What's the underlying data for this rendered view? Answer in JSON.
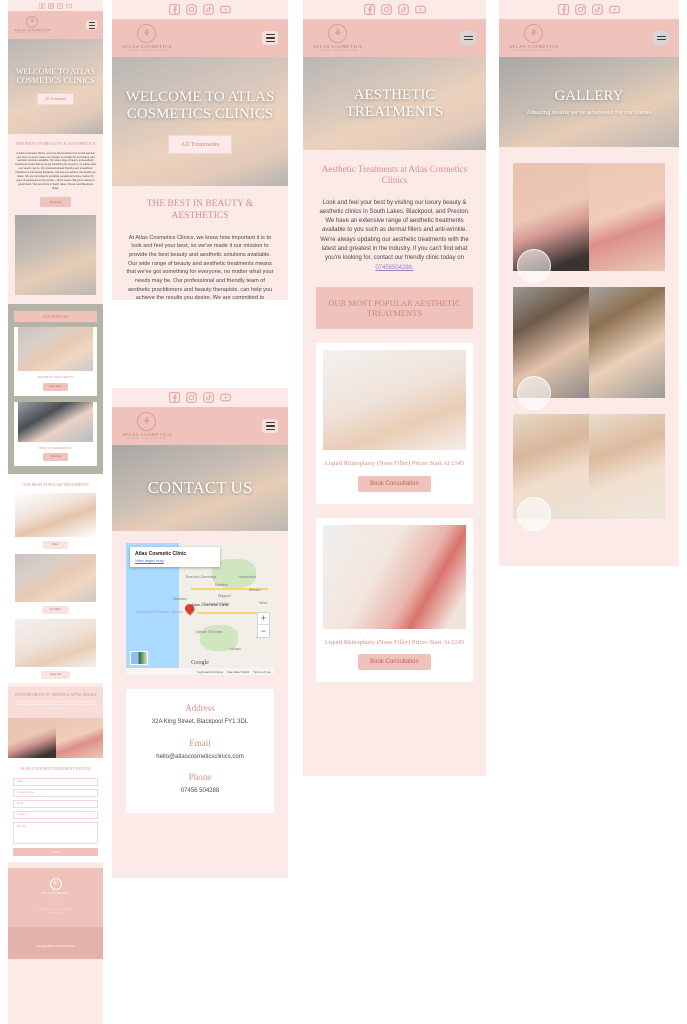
{
  "brand": {
    "name": "ATLAS COSMETICS",
    "tagline": "COSMETIC CLINIC & ACADEMY",
    "accent": "#d98f87",
    "band": "#efc3bc",
    "page_bg": "#fbeae7"
  },
  "social": [
    {
      "name": "facebook-icon",
      "label": "Facebook"
    },
    {
      "name": "instagram-icon",
      "label": "Instagram"
    },
    {
      "name": "tiktok-icon",
      "label": "TikTok"
    },
    {
      "name": "youtube-icon",
      "label": "YouTube"
    }
  ],
  "screens": [
    {
      "id": "home",
      "hero_title": "WELCOME TO ATLAS COSMETICS CLINICS",
      "hero_button": "All Treatments",
      "section_title": "THE BEST IN BEAUTY & AESTHETICS",
      "body": "At Atlas Cosmetics Clinics, we know how important it is to look and feel your best, so we've made it our mission to provide the best beauty and aesthetic solutions available. Our wide range of beauty and aesthetic treatments means that we've got something for everyone, no matter what your needs may be. Our professional and friendly team of aesthetic practitioners and beauty therapists, can help you achieve the results you desire. We are committed to providing exceptional service, backed by years of experience in the industry—which means that you're always in good hands. Visit our clinics in South Lakes, Preston and Blackpool today!",
      "about_button": "About Us",
      "services_band": "OUR SERVICES",
      "services": [
        {
          "title": "AESTHETIC TREATMENTS",
          "button": "View Here"
        },
        {
          "title": "BEAUTY TREATMENTS",
          "button": "About Us"
        }
      ],
      "popular_title": "OUR MOST POPULAR TREATMENTS",
      "popular": [
        {
          "button": "Botox"
        },
        {
          "button": "Lip Fillers"
        },
        {
          "button": "Nose Job"
        }
      ],
      "results_title": "STUNNING RESULTS - BEFORE & AFTER IMAGES",
      "results_body": "We offer non-surgical beauty & aesthetics treatments from our cosmetics clinics in South Lakes, Preston & Blackpool. Take a look at some of the results we've achieved for some of our clients.",
      "form_title": "BOOK YOUR NEXT TREATMENT WITH US",
      "form_fields": [
        {
          "placeholder": "Name",
          "type": "text"
        },
        {
          "placeholder": "Contact Number",
          "type": "text"
        },
        {
          "placeholder": "Email",
          "type": "text"
        },
        {
          "placeholder": "Location",
          "type": "select"
        },
        {
          "placeholder": "Message",
          "type": "textarea"
        }
      ],
      "form_submit": "Send",
      "footer_heading": "Contact",
      "footer_email": "hello@atlascosmeticsclinics.com",
      "footer_phone": "07456504288",
      "copyright": "Copyright Atlas Cosmetics Clinics"
    },
    {
      "id": "contact",
      "hero_title": "CONTACT US",
      "map_card_title": "Atlas Cosmetic Clinic",
      "map_card_link": "View larger map",
      "map_pin_label": "Atlas Cosmetic Clinic",
      "map_labels": [
        "Thornton-Cleveleys",
        "Hambleton",
        "Stalmine",
        "Skippool",
        "Bispham",
        "Poulton-le-Fylde",
        "Weeton",
        "Wrea",
        "Blackpool Pleasure Beach",
        "Lytham St Annes",
        "Lytham",
        "Ansd"
      ],
      "map_logo": "Google",
      "map_footer": [
        "Keyboard shortcuts",
        "Map data ©2022",
        "Terms of Use"
      ],
      "map_zoom_in": "+",
      "map_zoom_out": "−",
      "details": [
        {
          "label": "Address",
          "value": "32A King Street, Blackpool FY1 3DL"
        },
        {
          "label": "Email",
          "value": "hello@atlascosmeticsclinics.com"
        },
        {
          "label": "Phone",
          "value": "07456 504288"
        }
      ]
    },
    {
      "id": "aesthetic",
      "hero_title": "AESTHETIC TREATMENTS",
      "section_title": "Aesthetic Treatments at Atlas Cosmetics Clinics",
      "body_pre": "Look and feel your best by visiting our luxury beauty & aesthetic clinics in South Lakes, Blackpool, and Preston. We have an extensive range of aesthetic treatments available to you such as dermal fillers and anti-wrinkle. We're always updating our aesthetic treatments with the latest and greatest in the industry. If you can't find what you're looking for, contact our friendly clinic today on ",
      "body_link": "07456504288.",
      "band": "OUR MOST POPULAR AESTHETIC TREATMENTS",
      "cards": [
        {
          "title": "Liquid Rhinoplasty (Nose Filler) Prices Start At £145",
          "button": "Book Consultation"
        },
        {
          "title": "Liquid Rhinoplasty (Nose Filler) Prices Start At £145",
          "button": "Book Consultation"
        }
      ]
    },
    {
      "id": "gallery",
      "hero_title": "GALLERY",
      "hero_sub": "Amazing results we've acheioved for our clients",
      "items": [
        {
          "name": "lip-filler-before-after"
        },
        {
          "name": "nose-profile-before-after"
        },
        {
          "name": "face-front-before-after"
        }
      ]
    }
  ]
}
